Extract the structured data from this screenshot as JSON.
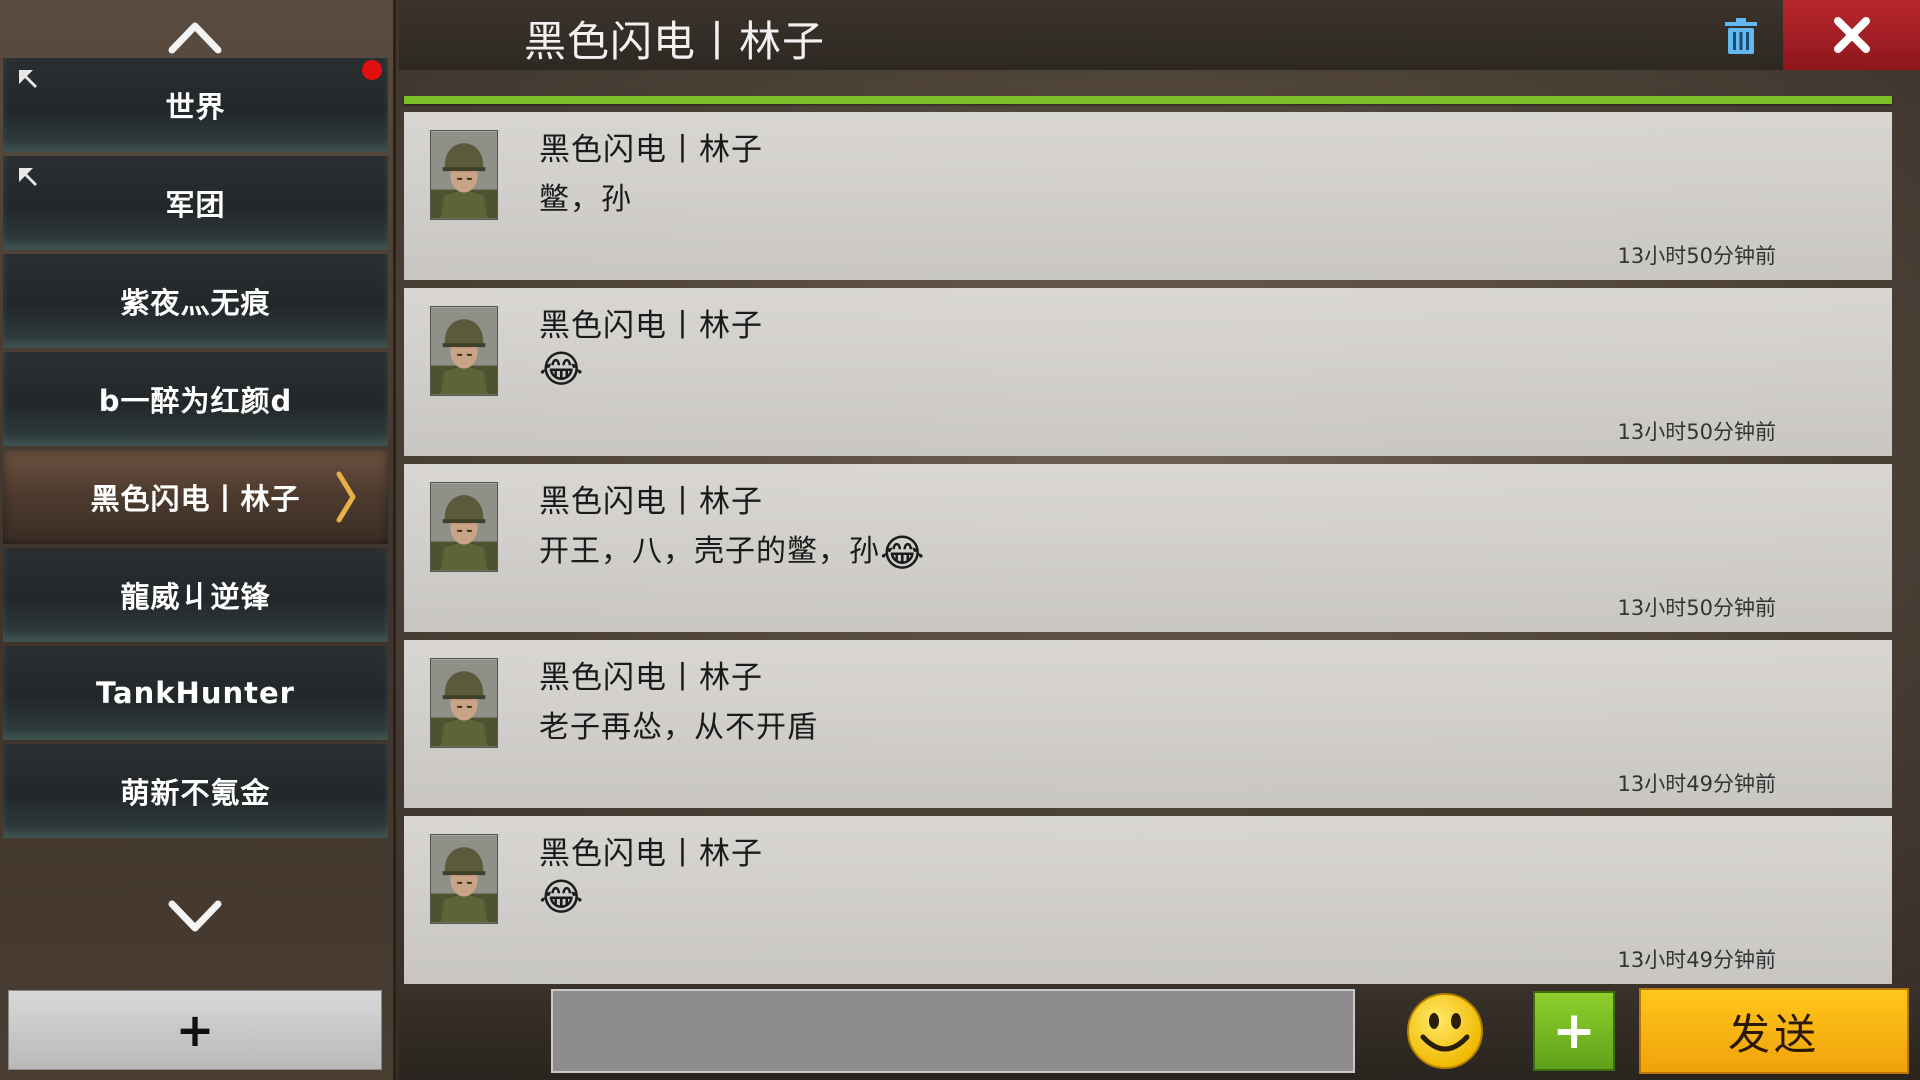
{
  "sidebar": {
    "scroll_up_icon": "chevron-up-icon",
    "scroll_down_icon": "chevron-down-icon",
    "channels": [
      {
        "label": "世界",
        "pinned": true,
        "unread_dot": true
      },
      {
        "label": "军团",
        "pinned": true,
        "unread_dot": false
      },
      {
        "label": "紫夜灬无痕",
        "pinned": false,
        "unread_dot": false
      },
      {
        "label": "b一醉为红颜d",
        "pinned": false,
        "unread_dot": false
      },
      {
        "label": "黑色闪电丨林子",
        "pinned": false,
        "unread_dot": false,
        "active": true
      },
      {
        "label": "龍威丩逆锋",
        "pinned": false,
        "unread_dot": false
      },
      {
        "label": "TankHunter",
        "pinned": false,
        "unread_dot": false
      },
      {
        "label": "萌新不氪金",
        "pinned": false,
        "unread_dot": false
      }
    ],
    "add_label": "+"
  },
  "header": {
    "title": "黑色闪电丨林子",
    "trash_icon": "trash-icon",
    "close_icon": "close-icon"
  },
  "messages": [
    {
      "name": "黑色闪电丨林子",
      "text": "鳖，孙",
      "emoji": "",
      "time": "13小时50分钟前"
    },
    {
      "name": "黑色闪电丨林子",
      "text": "",
      "emoji": "😂",
      "time": "13小时50分钟前"
    },
    {
      "name": "黑色闪电丨林子",
      "text": "开王，八，壳子的鳖，孙",
      "emoji": "😂",
      "time": "13小时50分钟前"
    },
    {
      "name": "黑色闪电丨林子",
      "text": "老子再怂，从不开盾",
      "emoji": "",
      "time": "13小时49分钟前"
    },
    {
      "name": "黑色闪电丨林子",
      "text": "",
      "emoji": "😂",
      "time": "13小时49分钟前"
    }
  ],
  "input": {
    "value": "",
    "placeholder": ""
  },
  "bottom": {
    "emoji_icon": "smiley-icon",
    "plus_label": "+",
    "send_label": "发送"
  },
  "colors": {
    "accent_green": "#7bbf2a",
    "close_red": "#b8262c",
    "send_yellow": "#ffc61a",
    "unread_red": "#e01010"
  }
}
